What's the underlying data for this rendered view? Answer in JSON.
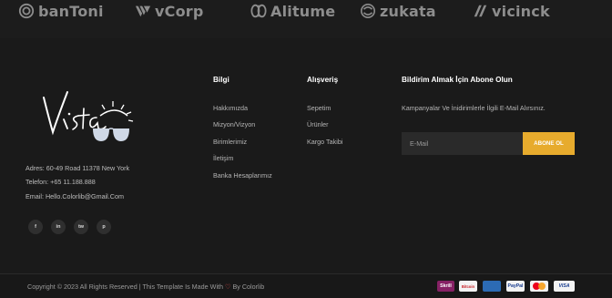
{
  "brands": [
    "banToni",
    "vCorp",
    "Alitume",
    "zukata",
    "vicinck"
  ],
  "footer": {
    "address": "Adres: 60-49 Road 11378 New York",
    "phone": "Telefon: +65 11.188.888",
    "email": "Email: Hello.Colorlib@Gmail.Com",
    "social": [
      "f",
      "in",
      "tw",
      "p"
    ]
  },
  "columns": {
    "bilgi": {
      "title": "Bilgi",
      "links": [
        "Hakkımızda",
        "Mizyon/Vizyon",
        "Birimlerimiz",
        "İletişim",
        "Banka Hesaplarımız"
      ]
    },
    "alisveris": {
      "title": "Alışveriş",
      "links": [
        "Sepetim",
        "Ürünler",
        "Kargo Takibi"
      ]
    },
    "newsletter": {
      "title": "Bildirim Almak İçin Abone Olun",
      "text": "Kampanyalar Ve İnidirimlerle İlgili E-Mail Alırsınız.",
      "placeholder": "E-Mail",
      "button": "ABONE OL"
    }
  },
  "bottom": {
    "copyright_prefix": "Copyright © 2023 All Rights Reserved | This Template Is Made With ",
    "copyright_suffix": " By Colorlib",
    "payments": [
      "Skrill",
      "Bitcoin",
      "Visa",
      "PayPal",
      "Mastercard",
      "VISA"
    ]
  },
  "colors": {
    "background": "#1a1a1a",
    "accent": "#e7ab2d",
    "heart": "#e24c4c"
  }
}
